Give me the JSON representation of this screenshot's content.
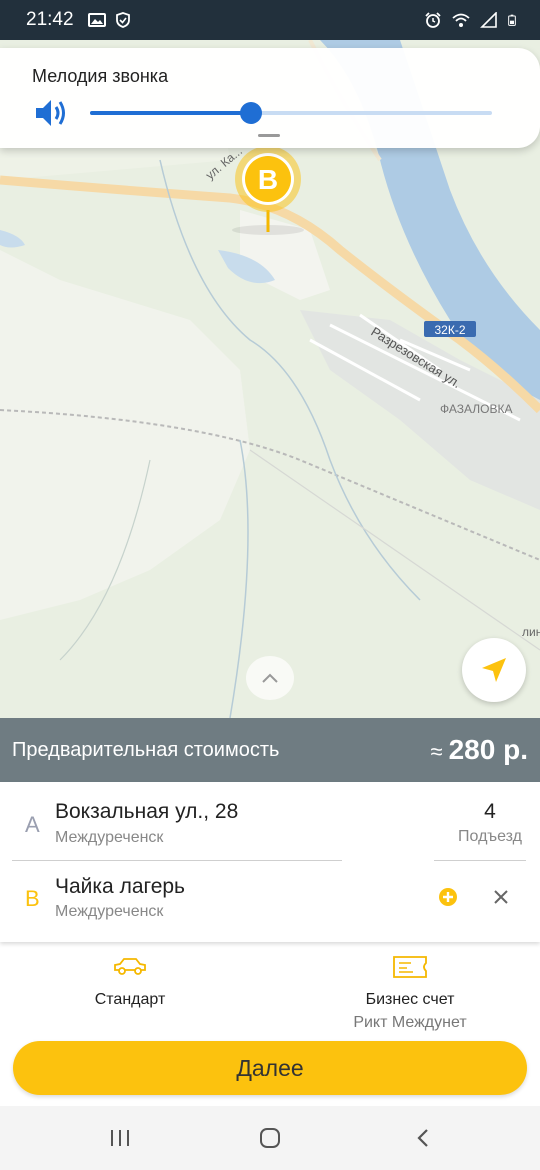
{
  "status_bar": {
    "time": "21:42",
    "left_icons": [
      "image-icon",
      "shield-icon"
    ],
    "right_icons": [
      "alarm-icon",
      "wifi-icon",
      "signal-icon",
      "battery-icon"
    ]
  },
  "volume_popup": {
    "title": "Мелодия звонка",
    "level_fraction": 0.4
  },
  "map": {
    "labels": {
      "street_top": "ул. Ка...",
      "street_river": "Разрезовская ул.",
      "road_badge": "32К-2",
      "village": "ФАЗАЛОВКА",
      "edge_label": "лин"
    },
    "marker_letter": "B",
    "colors": {
      "marker": "#fcc20e",
      "water": "#aecbe4",
      "road": "#f6d9a6"
    }
  },
  "price_bar": {
    "label": "Предварительная стоимость",
    "approx": "≈",
    "value": "280 р."
  },
  "route": {
    "from": {
      "letter": "A",
      "address": "Вокзальная ул., 28",
      "city": "Междуреченск",
      "entrance": "4",
      "entrance_label": "Подъезд"
    },
    "to": {
      "letter": "B",
      "address": "Чайка лагерь",
      "city": "Междуреченск"
    }
  },
  "options": {
    "tariff": {
      "icon": "car-icon",
      "label": "Стандарт"
    },
    "payment": {
      "icon": "ticket-icon",
      "label": "Бизнес счет",
      "sub": "Рикт Междунет"
    }
  },
  "next_button": {
    "label": "Далее"
  },
  "colors": {
    "accent": "#fcc20e",
    "price_bar": "#6f7c82",
    "status_bar": "#22303c"
  }
}
